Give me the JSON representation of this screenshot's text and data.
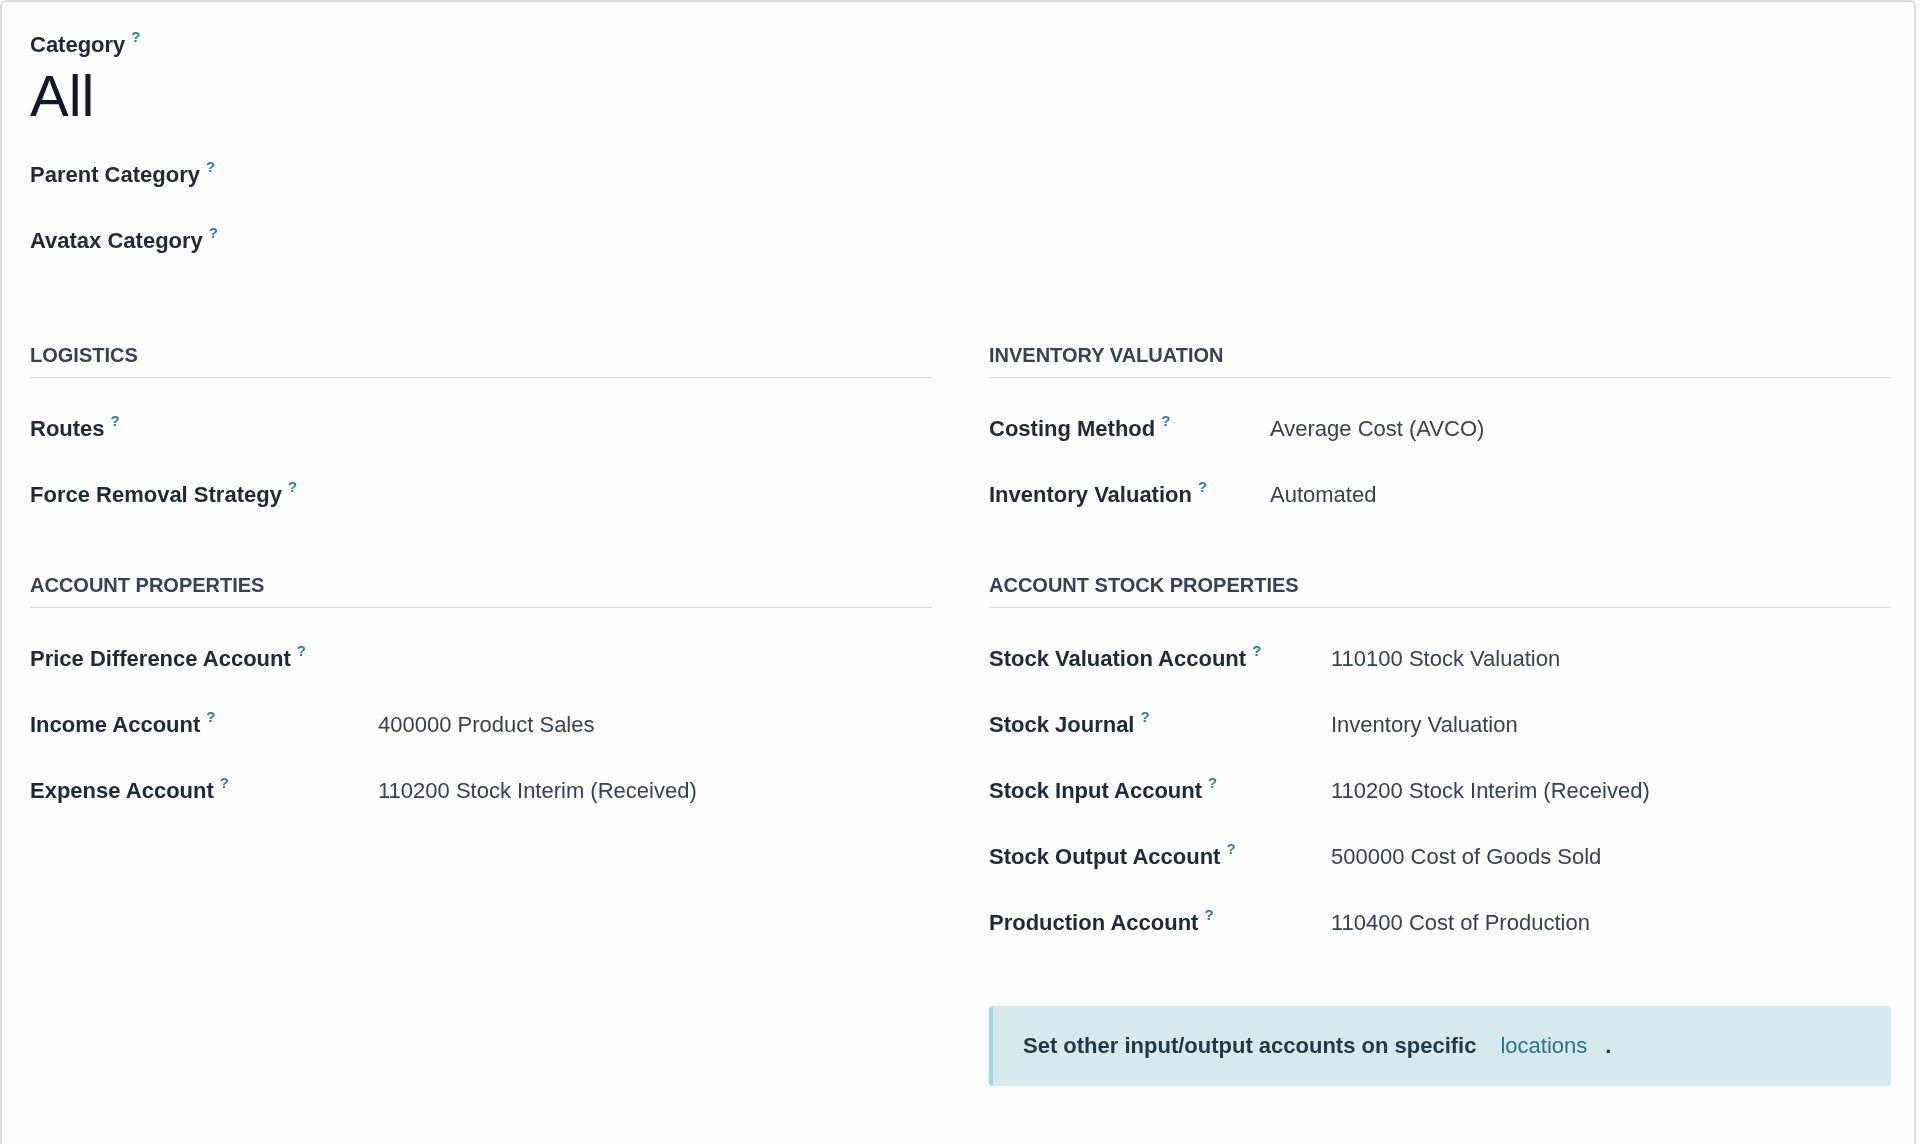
{
  "header": {
    "label": "Category",
    "help": "?",
    "value": "All"
  },
  "fields": [
    {
      "label": "Parent Category",
      "help": "?"
    },
    {
      "label": "Avatax Category",
      "help": "?"
    }
  ],
  "sections": [
    {
      "title": "LOGISTICS",
      "fields": [
        {
          "label": "Routes",
          "help": "?"
        },
        {
          "label": "Force Removal Strategy",
          "help": "?"
        }
      ]
    },
    {
      "title": "INVENTORY VALUATION",
      "fields": [
        {
          "label": "Costing Method",
          "help": "?",
          "value": "Average Cost (AVCO)"
        },
        {
          "label": "Inventory Valuation",
          "help": "?",
          "value": "Automated"
        }
      ]
    },
    {
      "title": "ACCOUNT PROPERTIES",
      "fields": [
        {
          "label": "Price Difference Account",
          "help": "?"
        },
        {
          "label": "Income Account",
          "help": "?",
          "value": "400000 Product Sales"
        },
        {
          "label": "Expense Account",
          "help": "?",
          "value": "110200 Stock Interim (Received)"
        }
      ]
    },
    {
      "title": "ACCOUNT STOCK PROPERTIES",
      "fields": [
        {
          "label": "Stock Valuation Account",
          "help": "?",
          "value": "110100 Stock Valuation"
        },
        {
          "label": "Stock Journal",
          "help": "?",
          "value": "Inventory Valuation"
        },
        {
          "label": "Stock Input Account",
          "help": "?",
          "value": "110200 Stock Interim (Received)"
        },
        {
          "label": "Stock Output Account",
          "help": "?",
          "value": "500000 Cost of Goods Sold"
        },
        {
          "label": "Production Account",
          "help": "?",
          "value": "110400 Cost of Production"
        }
      ],
      "note": {
        "text": "Set other input/output accounts on specific",
        "link": "locations",
        "after": "."
      }
    }
  ]
}
